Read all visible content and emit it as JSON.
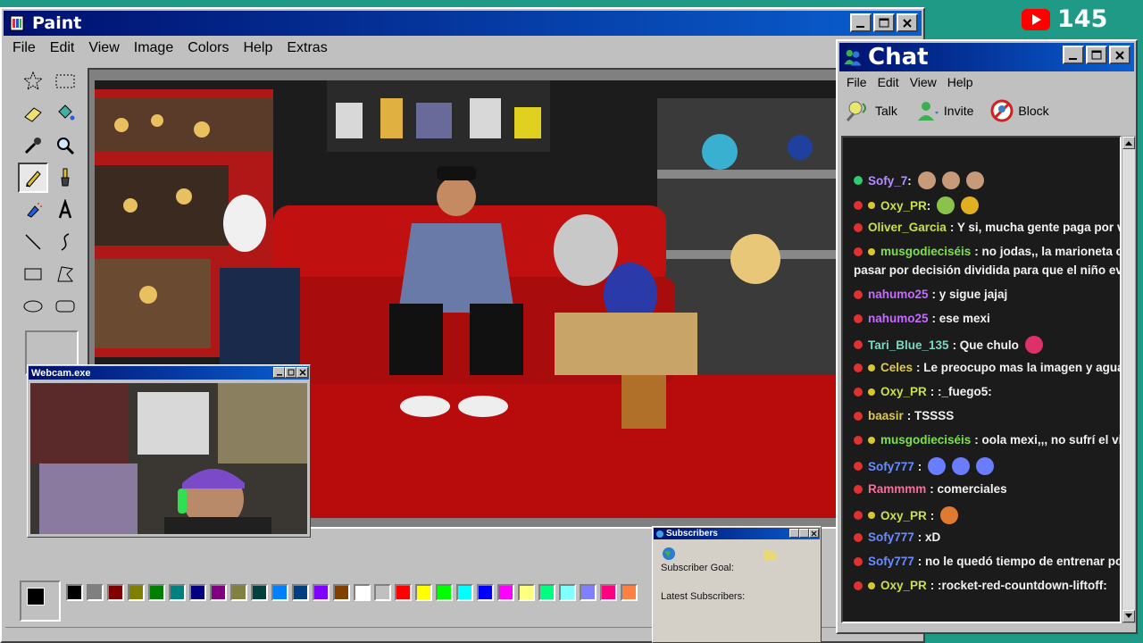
{
  "stream_badge": {
    "icon": "youtube-icon",
    "viewer_count": "145",
    "color": "#ff0000"
  },
  "paint": {
    "title": "Paint",
    "menu": [
      "File",
      "Edit",
      "View",
      "Image",
      "Colors",
      "Help",
      "Extras"
    ],
    "tools": [
      "free-select",
      "rect-select",
      "eraser",
      "fill",
      "color-picker",
      "magnifier",
      "pencil",
      "brush",
      "airbrush",
      "text",
      "line",
      "curve",
      "rectangle",
      "polygon",
      "ellipse",
      "rounded-rectangle"
    ],
    "active_tool": "pencil",
    "palette": [
      "#000000",
      "#808080",
      "#800000",
      "#808000",
      "#008000",
      "#008080",
      "#000080",
      "#800080",
      "#808040",
      "#004040",
      "#0080ff",
      "#004080",
      "#8000ff",
      "#804000",
      "#ffffff",
      "#c0c0c0",
      "#ff0000",
      "#ffff00",
      "#00ff00",
      "#00ffff",
      "#0000ff",
      "#ff00ff",
      "#ffff80",
      "#00ff80",
      "#80ffff",
      "#8080ff",
      "#ff0080",
      "#ff8040"
    ],
    "foreground": "#000000",
    "background": "#ffffff"
  },
  "webcam": {
    "title": "Webcam.exe"
  },
  "subscribers": {
    "title": "Subscribers",
    "goal_label": "Subscriber Goal:",
    "latest_label": "Latest Subscribers:"
  },
  "chat": {
    "title": "Chat",
    "menu": [
      "File",
      "Edit",
      "View",
      "Help"
    ],
    "toolbar": {
      "talk": "Talk",
      "invite": "Invite",
      "block": "Block"
    },
    "messages": [
      {
        "user": "Sofy_7",
        "text": "",
        "user_color": "#b78cff",
        "badge": "#2ecc71",
        "mod": false,
        "emotes": [
          "#c79a7a",
          "#c79a7a",
          "#c79a7a"
        ]
      },
      {
        "user": "Oxy_PR",
        "text": "",
        "user_color": "#c9e04a",
        "badge": "#e03030",
        "mod": true,
        "emotes": [
          "#8bc34a",
          "#e0b020"
        ]
      },
      {
        "user": "Oliver_Garcia",
        "text": ": Y si, mucha gente paga por ver c",
        "user_color": "#c9e04a",
        "badge": "#e03030",
        "mod": false,
        "emotes": []
      },
      {
        "user": "musgodieciséis",
        "text": ": no jodas,, la marioneta con",
        "user_color": "#7ee04a",
        "badge": "#e03030",
        "mod": true,
        "emotes": []
      },
      {
        "user": "",
        "text": "pasar por decisión dividida para que el niño evite e",
        "user_color": "#f2f2f2",
        "badge": "",
        "mod": false,
        "emotes": []
      },
      {
        "user": "nahumo25",
        "text": ": y sigue jajaj",
        "user_color": "#c56bff",
        "badge": "#e03030",
        "mod": false,
        "emotes": []
      },
      {
        "user": "nahumo25",
        "text": ": ese mexi",
        "user_color": "#c56bff",
        "badge": "#e03030",
        "mod": false,
        "emotes": []
      },
      {
        "user": "Tari_Blue_135",
        "text": ": Que chulo",
        "user_color": "#7fd6c2",
        "badge": "#e03030",
        "mod": false,
        "emotes": [
          "#e0306a"
        ]
      },
      {
        "user": "Celes",
        "text": ": Le preocupo mas la imagen y aguanta",
        "user_color": "#e0c94a",
        "badge": "#e03030",
        "mod": true,
        "emotes": []
      },
      {
        "user": "Oxy_PR",
        "text": ": :_fuego5:",
        "user_color": "#c9e04a",
        "badge": "#e03030",
        "mod": true,
        "emotes": []
      },
      {
        "user": "baasir",
        "text": ": TSSSS",
        "user_color": "#e0c94a",
        "badge": "#e03030",
        "mod": false,
        "emotes": []
      },
      {
        "user": "musgodieciséis",
        "text": ": oola mexi,,, no sufrí el visio",
        "user_color": "#7ee04a",
        "badge": "#e03030",
        "mod": true,
        "emotes": []
      },
      {
        "user": "Sofy777",
        "text": ":",
        "user_color": "#6a8cff",
        "badge": "#e03030",
        "mod": false,
        "emotes": [
          "#6a7cff",
          "#6a7cff",
          "#6a7cff"
        ]
      },
      {
        "user": "Rammmm",
        "text": ": comerciales",
        "user_color": "#ff6a9a",
        "badge": "#e03030",
        "mod": false,
        "emotes": []
      },
      {
        "user": "Oxy_PR",
        "text": ":",
        "user_color": "#c9e04a",
        "badge": "#e03030",
        "mod": true,
        "emotes": [
          "#e07a30"
        ]
      },
      {
        "user": "Sofy777",
        "text": ": xD",
        "user_color": "#6a8cff",
        "badge": "#e03030",
        "mod": false,
        "emotes": []
      },
      {
        "user": "Sofy777",
        "text": ": no le quedó tiempo de entrenar por",
        "user_color": "#6a8cff",
        "badge": "#e03030",
        "mod": false,
        "emotes": []
      },
      {
        "user": "Oxy_PR",
        "text": ": :rocket-red-countdown-liftoff:",
        "user_color": "#c9e04a",
        "badge": "#e03030",
        "mod": true,
        "emotes": []
      }
    ]
  }
}
